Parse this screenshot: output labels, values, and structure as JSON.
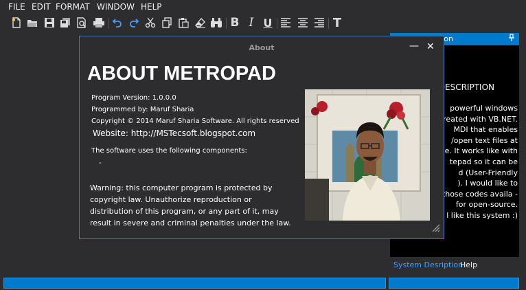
{
  "menu": [
    "FILE",
    "EDIT",
    "FORMAT",
    "WINDOW",
    "HELP"
  ],
  "toolbar": {
    "buttons": [
      "new-file-icon",
      "open-folder-icon",
      "save-icon",
      "save-all-icon",
      "print-preview-icon",
      "print-icon",
      "undo-icon",
      "redo-icon",
      "cut-icon",
      "copy-icon",
      "paste-icon",
      "eraser-icon",
      "find-icon",
      "bold-icon",
      "italic-icon",
      "underline-icon",
      "align-left-icon",
      "align-center-icon",
      "align-right-icon",
      "font-icon"
    ],
    "bold_glyph": "B",
    "italic_glyph": "I",
    "underline_glyph": "U",
    "font_glyph": "T"
  },
  "side_panel": {
    "header_title": "ion",
    "heading": "DESCRIPTION",
    "lines": [
      "powerful windows",
      "reated with VB.NET.",
      "MDI that enables",
      "/open text files at",
      "e. It works like with",
      "tepad so it can be",
      "d (User-Friendly",
      "). I would like to",
      "those codes availa -",
      "for open-source.",
      "l like this system :)"
    ],
    "tabs": [
      "System Desription",
      "Help"
    ]
  },
  "dialog": {
    "title": "About",
    "minimize_glyph": "—",
    "close_glyph": "✕",
    "heading": "ABOUT METROPAD",
    "version": "Program Version: 1.0.0.0",
    "programmer": "Programmed by: Maruf Sharia",
    "copyright": "Copyright © 2014 Maruf Sharia Software. All rights reserved",
    "website": "Website: http://MSTecsoft.blogspot.com",
    "components_label": "The software uses the following components:",
    "components_item": "-",
    "warning": "Warning: this computer program is protected by copyright law. Unauthorize reproduction  or distribution of this program, or any part of it, may result in severe and criminal penalties under the law."
  },
  "colors": {
    "accent": "#007acc",
    "background": "#2d2d30",
    "panel": "#000000"
  }
}
